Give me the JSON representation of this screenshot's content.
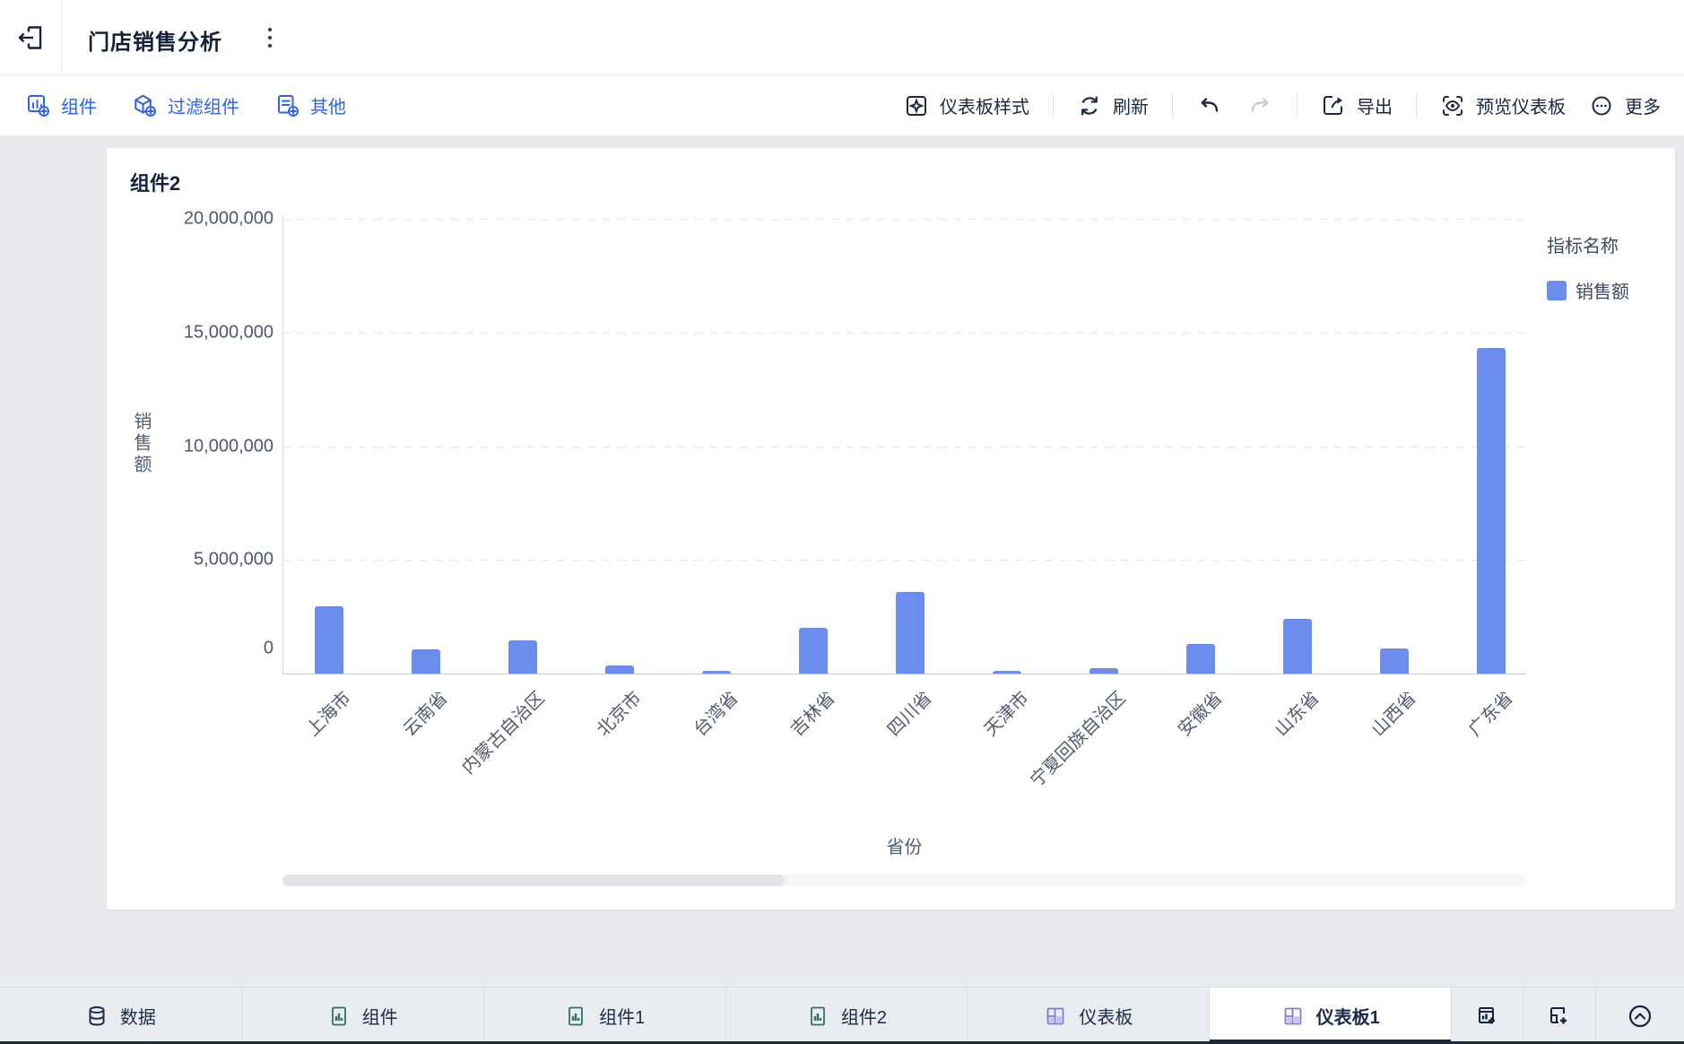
{
  "header": {
    "title": "门店销售分析"
  },
  "toolbar": {
    "left": [
      {
        "label": "组件"
      },
      {
        "label": "过滤组件"
      },
      {
        "label": "其他"
      }
    ],
    "right": [
      {
        "label": "仪表板样式"
      },
      {
        "label": "刷新"
      },
      {
        "label": "导出"
      },
      {
        "label": "预览仪表板"
      },
      {
        "label": "更多"
      }
    ]
  },
  "chart_data": {
    "type": "bar",
    "title": "组件2",
    "categories": [
      "上海市",
      "云南省",
      "内蒙古自治区",
      "北京市",
      "台湾省",
      "吉林省",
      "四川省",
      "天津市",
      "宁夏回族自治区",
      "安徽省",
      "山东省",
      "山西省",
      "广东省"
    ],
    "values": [
      2950000,
      1050000,
      1450000,
      350000,
      130000,
      2000000,
      3600000,
      100000,
      230000,
      1300000,
      2400000,
      1100000,
      14300000
    ],
    "series": [
      {
        "name": "销售额"
      }
    ],
    "xlabel": "省份",
    "ylabel": "销售额",
    "ylim": [
      0,
      20000000
    ],
    "yticks": [
      {
        "label": "0",
        "value": 0
      },
      {
        "label": "5,000,000",
        "value": 5000000
      },
      {
        "label": "10,000,000",
        "value": 10000000
      },
      {
        "label": "15,000,000",
        "value": 15000000
      },
      {
        "label": "20,000,000",
        "value": 20000000
      }
    ],
    "legend_title": "指标名称",
    "legend_position": "right",
    "grid": true,
    "bar_color": "#6d8cf0"
  },
  "tabbar": {
    "tabs": [
      {
        "label": "数据"
      },
      {
        "label": "组件"
      },
      {
        "label": "组件1"
      },
      {
        "label": "组件2"
      },
      {
        "label": "仪表板"
      },
      {
        "label": "仪表板1"
      }
    ],
    "active": "仪表板1"
  }
}
